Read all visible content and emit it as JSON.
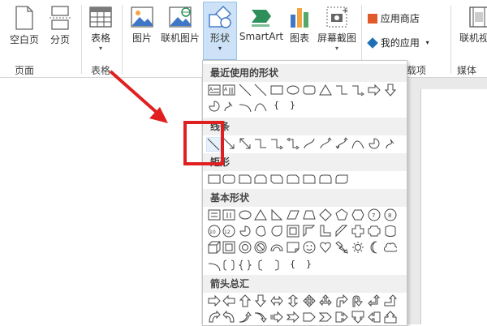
{
  "ribbon": {
    "buttons": {
      "blank_page": "空白页",
      "page_break": "分页",
      "table": "表格",
      "picture": "图片",
      "online_picture": "联机图片",
      "shapes": "形状",
      "smartart": "SmartArt",
      "chart": "图表",
      "screenshot": "屏幕截图",
      "app_store": "应用商店",
      "my_apps": "我的应用",
      "online_video": "联机视频"
    },
    "groups": {
      "pages": "页面",
      "tables": "表格",
      "addins_partial": "载项",
      "media": "媒体"
    }
  },
  "dropdown": {
    "sections": {
      "recent": "最近使用的形状",
      "lines": "线条",
      "rectangles": "矩形",
      "basic": "基本形状",
      "arrows": "箭头总汇"
    },
    "braces": {
      "open": "{",
      "close": "}"
    }
  },
  "colors": {
    "highlight": "#e02020",
    "app_store_icon": "#e05a2b",
    "my_apps_icon": "#1e6fb5",
    "smartart_icon": "#2f8f5b",
    "chart_bars": [
      "#3f77c6",
      "#f2a541",
      "#55a868"
    ]
  }
}
